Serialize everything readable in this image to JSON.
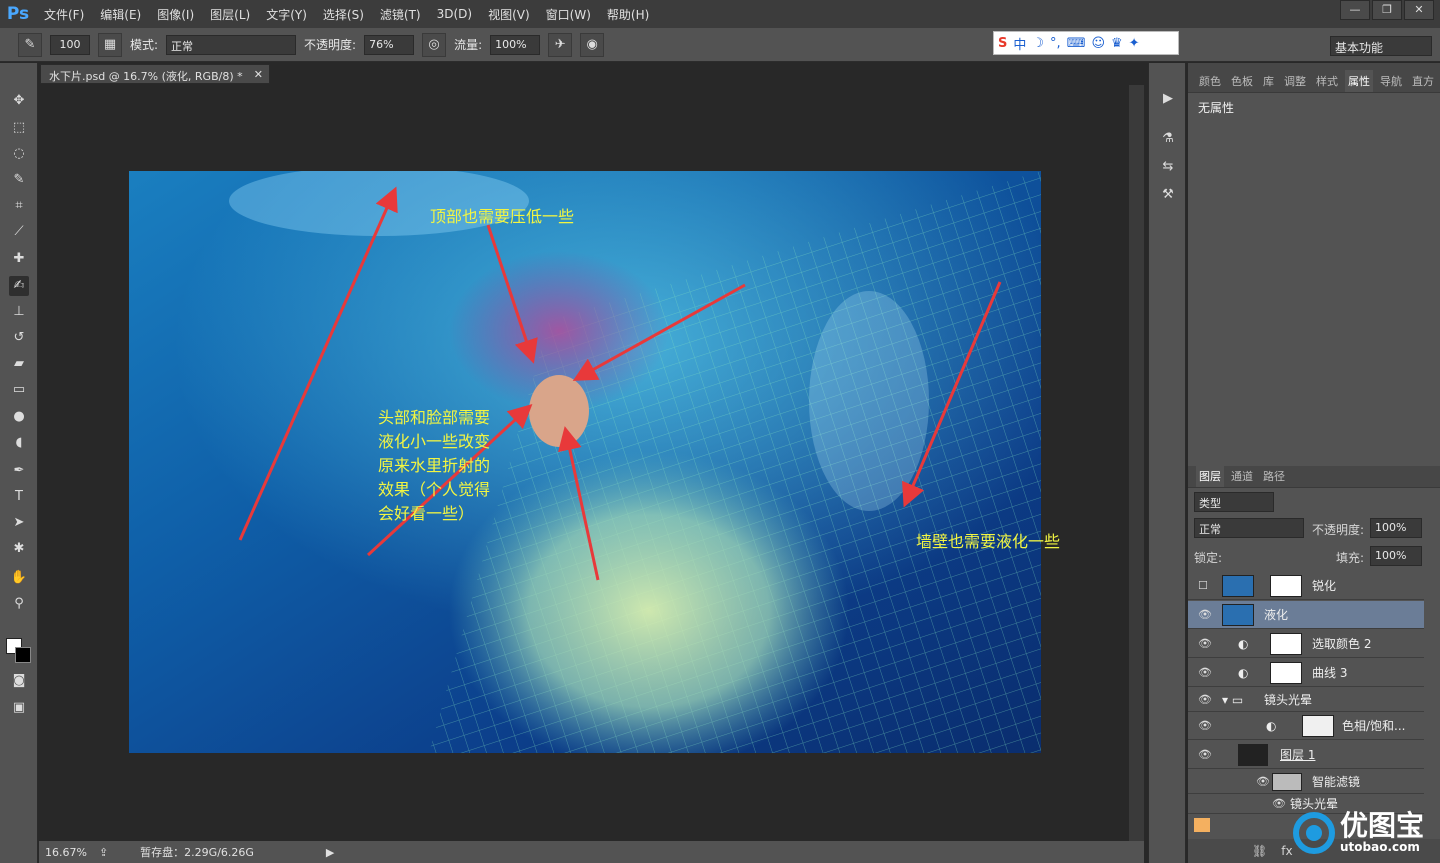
{
  "app": {
    "logo": "Ps"
  },
  "menu": [
    "文件(F)",
    "编辑(E)",
    "图像(I)",
    "图层(L)",
    "文字(Y)",
    "选择(S)",
    "滤镜(T)",
    "3D(D)",
    "视图(V)",
    "窗口(W)",
    "帮助(H)"
  ],
  "options": {
    "brush_size": "100",
    "mode_label": "模式:",
    "mode_value": "正常",
    "opacity_label": "不透明度:",
    "opacity_value": "76%",
    "flow_label": "流量:",
    "flow_value": "100%"
  },
  "workspace": "基本功能",
  "document_tab": "水下片.psd @ 16.7% (液化, RGB/8) *",
  "annotations": [
    "顶部也需要压低一些",
    "头部和脸部需要液化小一些改变原来水里折射的效果（个人觉得会好看一些）",
    "墙壁也需要液化一些"
  ],
  "status": {
    "zoom": "16.67%",
    "scratch": "暂存盘：2.29G/6.26G"
  },
  "properties_tabs": [
    "颜色",
    "色板",
    "库",
    "调整",
    "样式",
    "属性",
    "导航",
    "直方"
  ],
  "properties_active": "属性",
  "properties_body": "无属性",
  "layers_tabs": [
    "图层",
    "通道",
    "路径"
  ],
  "layers_filter": "类型",
  "blend_mode": "正常",
  "layer_opacity_label": "不透明度:",
  "layer_opacity": "100%",
  "lock_label": "锁定:",
  "fill_label": "填充:",
  "fill_value": "100%",
  "layers": [
    {
      "name": "锐化",
      "visible": false
    },
    {
      "name": "液化",
      "visible": true,
      "selected": true
    },
    {
      "name": "选取颜色 2",
      "visible": true
    },
    {
      "name": "曲线 3",
      "visible": true
    },
    {
      "name": "镜头光晕",
      "visible": true,
      "group": true
    },
    {
      "name": "色相/饱和...",
      "visible": true
    },
    {
      "name": "图层 1",
      "visible": true
    },
    {
      "name": "智能滤镜",
      "visible": true
    },
    {
      "name": "镜头光晕",
      "visible": true
    }
  ],
  "colors": {
    "annotation": "#f2f542",
    "arrow": "#e8393a",
    "selected_layer": "#6b7d97"
  },
  "watermark": {
    "title": "优图宝",
    "url": "utobao.com"
  }
}
